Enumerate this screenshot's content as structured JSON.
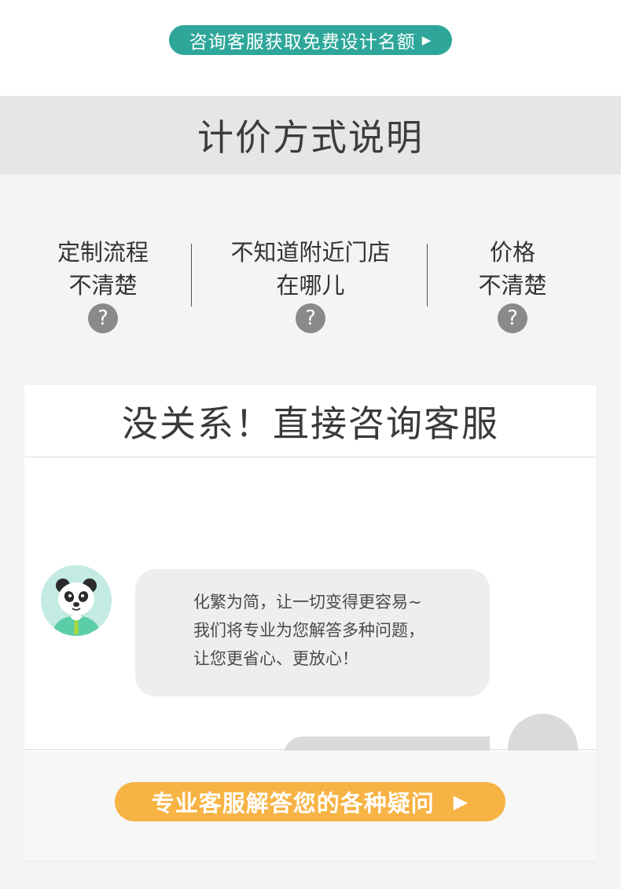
{
  "consult_button": {
    "label": "咨询客服获取免费设计名额",
    "arrow": "▶"
  },
  "section_title": "计价方式说明",
  "faq": [
    {
      "line1": "定制流程",
      "line2": "不清楚",
      "icon": "question-circle-icon",
      "mark": "?"
    },
    {
      "line1": "不知道附近门店",
      "line2": "在哪儿",
      "icon": "question-circle-icon",
      "mark": "?"
    },
    {
      "line1": "价格",
      "line2": "不清楚",
      "icon": "question-circle-icon",
      "mark": "?"
    }
  ],
  "card": {
    "heading": "没关系！直接咨询客服",
    "message_lines": [
      "化繁为简，让一切变得更容易~",
      "我们将专业为您解答多种问题，",
      "让您更省心、更放心！"
    ],
    "cta": {
      "label": "专业客服解答您的各种疑问",
      "arrow": "▶"
    }
  },
  "colors": {
    "teal": "#2ea79a",
    "orange": "#f7b344",
    "gray_icon": "#8a8a8a",
    "band": "#e6e6e6"
  },
  "icons": {
    "agent_avatar": "panda-avatar-icon",
    "user_avatar": "user-avatar-icon"
  }
}
